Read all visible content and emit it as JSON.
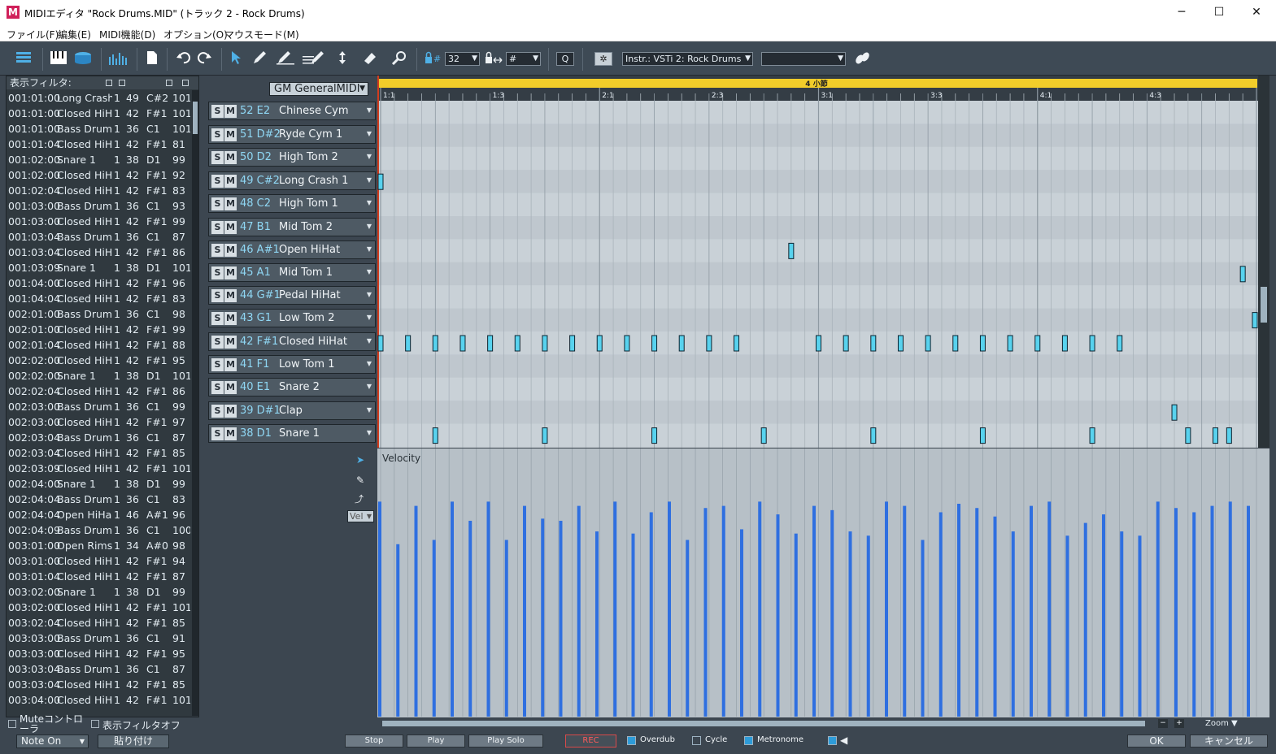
{
  "window": {
    "title": "MIDIエディタ \"Rock Drums.MID\" (トラック 2 - Rock Drums)",
    "icon_letter": "M",
    "min_glyph": "─",
    "max_glyph": "☐",
    "close_glyph": "✕"
  },
  "menu": [
    "ファイル(F)",
    "編集(E)",
    "MIDI機能(D)",
    "オプション(O)",
    "マウスモード(M)"
  ],
  "toolbar": {
    "grid_value": "32",
    "snap_value": "#",
    "quantize_label": "Q",
    "instrument": "Instr.: VSTi 2: Rock Drums",
    "extra_select": "",
    "icons": [
      "list-view-icon",
      "piano-roll-icon",
      "drum-editor-icon",
      "velocity-bars-icon",
      "document-icon",
      "undo-icon",
      "redo-icon",
      "pointer-tool-icon",
      "pencil-tool-icon",
      "line-tool-icon",
      "draw-line-tool-icon",
      "transpose-tool-icon",
      "eraser-tool-icon",
      "magnify-tool-icon",
      "grid-lock-icon",
      "length-lock-icon",
      "settings-icon",
      "link-icon"
    ]
  },
  "event_filter": {
    "title": "表示フィルタ:",
    "rows": [
      [
        "001:01:00",
        "Long Crash",
        "1",
        "49",
        "C#2",
        "101"
      ],
      [
        "001:01:00",
        "Closed HiH",
        "1",
        "42",
        "F#1",
        "101"
      ],
      [
        "001:01:00",
        "Bass Drum",
        "1",
        "36",
        "C1",
        "101"
      ],
      [
        "001:01:04",
        "Closed HiH",
        "1",
        "42",
        "F#1",
        "81"
      ],
      [
        "001:02:00",
        "Snare 1",
        "1",
        "38",
        "D1",
        "99"
      ],
      [
        "001:02:00",
        "Closed HiH",
        "1",
        "42",
        "F#1",
        "92"
      ],
      [
        "001:02:04",
        "Closed HiH",
        "1",
        "42",
        "F#1",
        "83"
      ],
      [
        "001:03:00",
        "Bass Drum",
        "1",
        "36",
        "C1",
        "93"
      ],
      [
        "001:03:00",
        "Closed HiH",
        "1",
        "42",
        "F#1",
        "99"
      ],
      [
        "001:03:04",
        "Bass Drum",
        "1",
        "36",
        "C1",
        "87"
      ],
      [
        "001:03:04",
        "Closed HiH",
        "1",
        "42",
        "F#1",
        "86"
      ],
      [
        "001:03:09",
        "Snare 1",
        "1",
        "38",
        "D1",
        "101"
      ],
      [
        "001:04:00",
        "Closed HiH",
        "1",
        "42",
        "F#1",
        "96"
      ],
      [
        "001:04:04",
        "Closed HiH",
        "1",
        "42",
        "F#1",
        "83"
      ],
      [
        "002:01:00",
        "Bass Drum",
        "1",
        "36",
        "C1",
        "98"
      ],
      [
        "002:01:00",
        "Closed HiH",
        "1",
        "42",
        "F#1",
        "99"
      ],
      [
        "002:01:04",
        "Closed HiH",
        "1",
        "42",
        "F#1",
        "88"
      ],
      [
        "002:02:00",
        "Closed HiH",
        "1",
        "42",
        "F#1",
        "95"
      ],
      [
        "002:02:00",
        "Snare 1",
        "1",
        "38",
        "D1",
        "101"
      ],
      [
        "002:02:04",
        "Closed HiH",
        "1",
        "42",
        "F#1",
        "86"
      ],
      [
        "002:03:00",
        "Bass Drum",
        "1",
        "36",
        "C1",
        "99"
      ],
      [
        "002:03:00",
        "Closed HiH",
        "1",
        "42",
        "F#1",
        "97"
      ],
      [
        "002:03:04",
        "Bass Drum",
        "1",
        "36",
        "C1",
        "87"
      ],
      [
        "002:03:04",
        "Closed HiH",
        "1",
        "42",
        "F#1",
        "85"
      ],
      [
        "002:03:09",
        "Closed HiH",
        "1",
        "42",
        "F#1",
        "101"
      ],
      [
        "002:04:00",
        "Snare 1",
        "1",
        "38",
        "D1",
        "99"
      ],
      [
        "002:04:04",
        "Bass Drum",
        "1",
        "36",
        "C1",
        "83"
      ],
      [
        "002:04:04",
        "Open HiHa",
        "1",
        "46",
        "A#1",
        "96"
      ],
      [
        "002:04:09",
        "Bass Drum",
        "1",
        "36",
        "C1",
        "100"
      ],
      [
        "003:01:00",
        "Open Rims",
        "1",
        "34",
        "A#0",
        "98"
      ],
      [
        "003:01:00",
        "Closed HiH",
        "1",
        "42",
        "F#1",
        "94"
      ],
      [
        "003:01:04",
        "Closed HiH",
        "1",
        "42",
        "F#1",
        "87"
      ],
      [
        "003:02:00",
        "Snare 1",
        "1",
        "38",
        "D1",
        "99"
      ],
      [
        "003:02:00",
        "Closed HiH",
        "1",
        "42",
        "F#1",
        "101"
      ],
      [
        "003:02:04",
        "Closed HiH",
        "1",
        "42",
        "F#1",
        "85"
      ],
      [
        "003:03:00",
        "Bass Drum",
        "1",
        "36",
        "C1",
        "91"
      ],
      [
        "003:03:00",
        "Closed HiH",
        "1",
        "42",
        "F#1",
        "95"
      ],
      [
        "003:03:04",
        "Bass Drum",
        "1",
        "36",
        "C1",
        "87"
      ],
      [
        "003:03:04",
        "Closed HiH",
        "1",
        "42",
        "F#1",
        "85"
      ],
      [
        "003:04:00",
        "Closed HiH",
        "1",
        "42",
        "F#1",
        "101"
      ]
    ]
  },
  "bottom_left": {
    "mute_label": "Muteコントローラ",
    "filter_off_label": "表示フィルタオフ",
    "note_on_select": "Note On",
    "paste_button": "貼り付け"
  },
  "drum_map": {
    "select": "GM GeneralMIDI",
    "tracks": [
      {
        "num": "52 E2",
        "name": "Chinese Cym"
      },
      {
        "num": "51 D#2",
        "name": "Ryde Cym 1"
      },
      {
        "num": "50 D2",
        "name": "High Tom 2"
      },
      {
        "num": "49 C#2",
        "name": "Long Crash 1"
      },
      {
        "num": "48 C2",
        "name": "High Tom 1"
      },
      {
        "num": "47 B1",
        "name": "Mid Tom 2"
      },
      {
        "num": "46 A#1",
        "name": "Open HiHat"
      },
      {
        "num": "45 A1",
        "name": "Mid Tom 1"
      },
      {
        "num": "44 G#1",
        "name": "Pedal HiHat"
      },
      {
        "num": "43 G1",
        "name": "Low Tom 2"
      },
      {
        "num": "42 F#1",
        "name": "Closed HiHat"
      },
      {
        "num": "41 F1",
        "name": "Low Tom 1"
      },
      {
        "num": "40 E1",
        "name": "Snare 2"
      },
      {
        "num": "39 D#1",
        "name": "Clap"
      },
      {
        "num": "38 D1",
        "name": "Snare 1"
      }
    ],
    "solo_label": "S",
    "mute_label": "M"
  },
  "timeline": {
    "bar_label": "4 小節",
    "markers": [
      "1:1",
      "1:3",
      "2:1",
      "2:3",
      "3:1",
      "3:3",
      "4:1",
      "4:3"
    ]
  },
  "notes": {
    "lanes": [
      "52 E2",
      "51 D#2",
      "50 D2",
      "49 C#2",
      "48 C2",
      "47 B1",
      "46 A#1",
      "45 A1",
      "44 G#1",
      "43 G1",
      "42 F#1",
      "41 F1",
      "40 E1",
      "39 D#1",
      "38 D1"
    ],
    "events": [
      {
        "lane": 3,
        "beat": 0.0
      },
      {
        "lane": 6,
        "beat": 7.5
      },
      {
        "lane": 7,
        "beat": 15.75
      },
      {
        "lane": 9,
        "beat": 15.97
      },
      {
        "lane": 13,
        "beat": 14.5
      },
      {
        "lane": 10,
        "beats": [
          0,
          0.5,
          1,
          1.5,
          2,
          2.5,
          3,
          3.5,
          4,
          4.5,
          5,
          5.5,
          6,
          6.5,
          8,
          8.5,
          9,
          9.5,
          10,
          10.5,
          11,
          11.5,
          12,
          12.5,
          13,
          13.5
        ]
      },
      {
        "lane": 14,
        "beats": [
          1,
          3,
          5,
          7,
          9,
          11,
          13,
          14.75,
          15.25,
          15.5
        ]
      }
    ]
  },
  "velocity": {
    "label": "Velocity",
    "vel_select": "Vel",
    "values": [
      101,
      81,
      99,
      83,
      101,
      92,
      101,
      83,
      99,
      93,
      92,
      99,
      87,
      101,
      86,
      96,
      101,
      83,
      98,
      99,
      88,
      101,
      95,
      86,
      99,
      97,
      87,
      85,
      101,
      99,
      83,
      96,
      100,
      98,
      94,
      87,
      99,
      101,
      85,
      91,
      95,
      87,
      85,
      101,
      98,
      96,
      99,
      101,
      99
    ]
  },
  "transport": {
    "stop": "Stop",
    "play": "Play",
    "play_solo": "Play Solo",
    "rec": "REC",
    "overdub": "Overdub",
    "cycle": "Cycle",
    "metronome": "Metronome",
    "ok": "OK",
    "cancel": "キャンセル",
    "zoom": "Zoom"
  },
  "colors": {
    "note_fill": "#58d2ee",
    "velocity_bar": "#2f6fe0",
    "playhead": "#d23c1e",
    "ruler_bar": "#f2cd2a",
    "rec_text": "#ff5a5a"
  }
}
